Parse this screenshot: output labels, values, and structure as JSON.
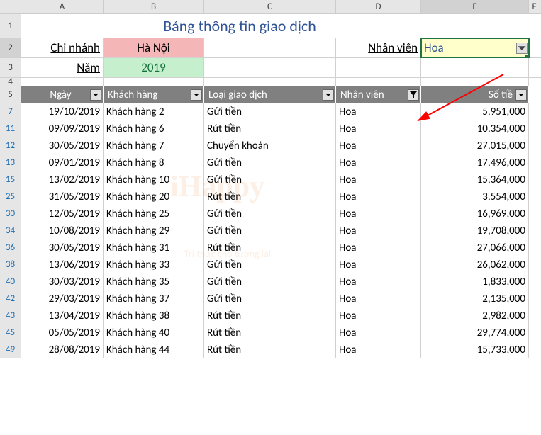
{
  "columns": [
    "A",
    "B",
    "C",
    "D",
    "E",
    "F"
  ],
  "selected_col": "E",
  "title_row": "1",
  "title": "Bảng thông tin giao dịch",
  "row2_num": "2",
  "row3_num": "3",
  "row4_num": "4",
  "row5_num": "5",
  "info": {
    "branch_label": "Chi nhánh",
    "branch_value": "Hà Nội",
    "year_label": "Năm",
    "year_value": "2019",
    "staff_label": "Nhân viên",
    "staff_value": "Hoa"
  },
  "headers": {
    "A": "Ngày",
    "B": "Khách hàng",
    "C": "Loại giao dịch",
    "D": "Nhân viên",
    "E": "Số tiề"
  },
  "rows": [
    {
      "n": "7",
      "date": "19/10/2019",
      "cust": "Khách hàng 2",
      "type": "Gửi tiền",
      "staff": "Hoa",
      "amt": "5,951,000"
    },
    {
      "n": "11",
      "date": "09/09/2019",
      "cust": "Khách hàng 6",
      "type": "Rút tiền",
      "staff": "Hoa",
      "amt": "10,354,000"
    },
    {
      "n": "12",
      "date": "30/05/2019",
      "cust": "Khách hàng 7",
      "type": "Chuyển khoản",
      "staff": "Hoa",
      "amt": "27,015,000"
    },
    {
      "n": "13",
      "date": "09/01/2019",
      "cust": "Khách hàng 8",
      "type": "Gửi tiền",
      "staff": "Hoa",
      "amt": "17,496,000"
    },
    {
      "n": "15",
      "date": "13/02/2019",
      "cust": "Khách hàng 10",
      "type": "Gửi tiền",
      "staff": "Hoa",
      "amt": "15,364,000"
    },
    {
      "n": "25",
      "date": "31/05/2019",
      "cust": "Khách hàng 20",
      "type": "Rút tiền",
      "staff": "Hoa",
      "amt": "3,554,000"
    },
    {
      "n": "30",
      "date": "12/05/2019",
      "cust": "Khách hàng 25",
      "type": "Gửi tiền",
      "staff": "Hoa",
      "amt": "16,969,000"
    },
    {
      "n": "34",
      "date": "10/08/2019",
      "cust": "Khách hàng 29",
      "type": "Gửi tiền",
      "staff": "Hoa",
      "amt": "19,708,000"
    },
    {
      "n": "36",
      "date": "30/05/2019",
      "cust": "Khách hàng 31",
      "type": "Rút tiền",
      "staff": "Hoa",
      "amt": "27,066,000"
    },
    {
      "n": "38",
      "date": "13/06/2019",
      "cust": "Khách hàng 33",
      "type": "Gửi tiền",
      "staff": "Hoa",
      "amt": "26,062,000"
    },
    {
      "n": "40",
      "date": "30/03/2019",
      "cust": "Khách hàng 35",
      "type": "Gửi tiền",
      "staff": "Hoa",
      "amt": "1,833,000"
    },
    {
      "n": "42",
      "date": "29/03/2019",
      "cust": "Khách hàng 37",
      "type": "Gửi tiền",
      "staff": "Hoa",
      "amt": "2,135,000"
    },
    {
      "n": "43",
      "date": "13/04/2019",
      "cust": "Khách hàng 38",
      "type": "Rút tiền",
      "staff": "Hoa",
      "amt": "2,982,000"
    },
    {
      "n": "45",
      "date": "05/05/2019",
      "cust": "Khách hàng 40",
      "type": "Rút tiền",
      "staff": "Hoa",
      "amt": "29,774,000"
    },
    {
      "n": "49",
      "date": "28/08/2019",
      "cust": "Khách hàng 44",
      "type": "Rút tiền",
      "staff": "Hoa",
      "amt": "15,733,000"
    }
  ],
  "watermark": "iHappy",
  "watermark2": "Tri thức cho tương lai"
}
